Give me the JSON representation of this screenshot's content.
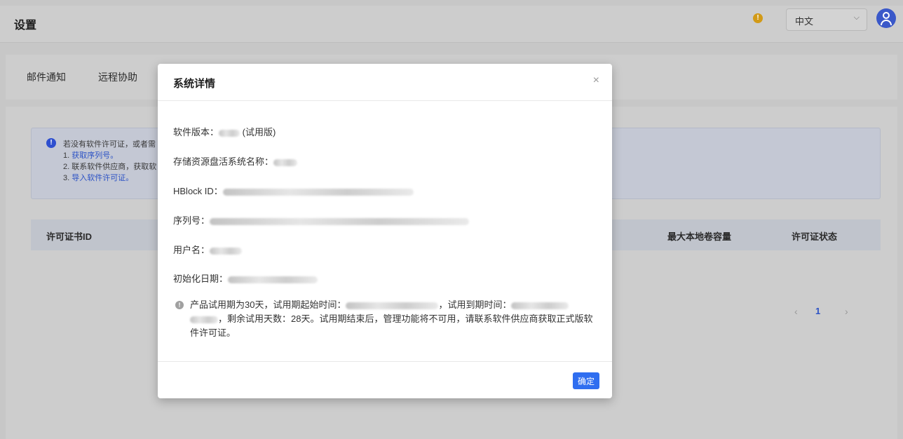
{
  "header": {
    "title": "设置",
    "language": "中文"
  },
  "tabs": [
    {
      "label": "邮件通知"
    },
    {
      "label": "远程协助"
    }
  ],
  "notice": {
    "line1": "若没有软件许可证，或者需",
    "line2_prefix": "1. ",
    "line2_link": "获取序列号。",
    "line3": "2. 联系软件供应商，获取软",
    "line4_prefix": "3. ",
    "line4_link": "导入软件许可证。"
  },
  "table": {
    "columns": [
      "许可证书ID",
      "最大本地卷容量",
      "许可证状态"
    ]
  },
  "pagination": {
    "prev": "‹",
    "current": "1",
    "next": "›"
  },
  "modal": {
    "title": "系统详情",
    "close": "×",
    "version_label": "软件版本：",
    "version_suffix": "(试用版)",
    "system_name_label": "存储资源盘活系统名称：",
    "hblock_label": "HBlock ID：",
    "serial_label": "序列号：",
    "username_label": "用户名：",
    "init_date_label": "初始化日期：",
    "info_part1": "产品试用期为30天，试用期起始时间：",
    "info_part2": "，试用到期时间：",
    "info_part3": "，剩余试用天数：28天。试用期结束后，管理功能将不可用，请联系软件供应商获取正式版软件许可证。",
    "ok_label": "确定"
  },
  "colors": {
    "accent": "#2f6ef0",
    "link": "#2c52c5",
    "warning": "#d29a17"
  }
}
